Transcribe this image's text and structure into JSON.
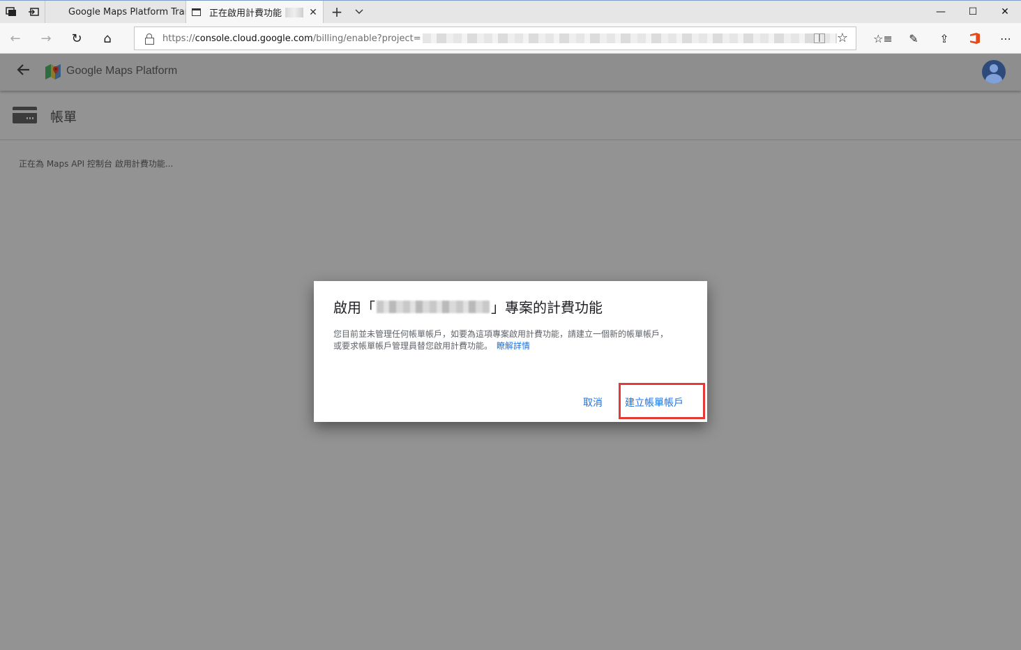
{
  "browser": {
    "tabs": [
      {
        "title": "Google Maps Platform Tran",
        "active": false
      },
      {
        "title": "正在啟用計費功能 -",
        "active": true
      }
    ],
    "address": {
      "url_scheme": "https://",
      "url_host": "console.cloud.google.com",
      "url_path": "/billing/enable?project="
    },
    "icons": {
      "tab_actions": "tab-actions-icon",
      "set_aside": "set-aside-tabs-icon",
      "new_tab": "+",
      "tab_menu": "chevron-down-icon",
      "back": "←",
      "forward": "→",
      "refresh": "↻",
      "home": "⌂",
      "favorite": "☆",
      "favorites_list": "☆≡",
      "notes": "✎",
      "share": "⇪",
      "more": "⋯",
      "minimize": "—",
      "maximize": "☐",
      "close": "✕"
    }
  },
  "app": {
    "brand": "Google Maps Platform",
    "section_title": "帳單",
    "status_text": "正在為 Maps API 控制台 啟用計費功能..."
  },
  "dialog": {
    "title_prefix": "啟用「",
    "title_suffix": "」專案的計費功能",
    "body": "您目前並未管理任何帳單帳戶，如要為這項專案啟用計費功能，請建立一個新的帳單帳戶，或要求帳單帳戶管理員替您啟用計費功能。",
    "learn_more": "瞭解詳情",
    "cancel_label": "取消",
    "create_label": "建立帳單帳戶"
  },
  "colors": {
    "link": "#1a73e8",
    "highlight": "#e53935",
    "overlay": "#939393"
  }
}
